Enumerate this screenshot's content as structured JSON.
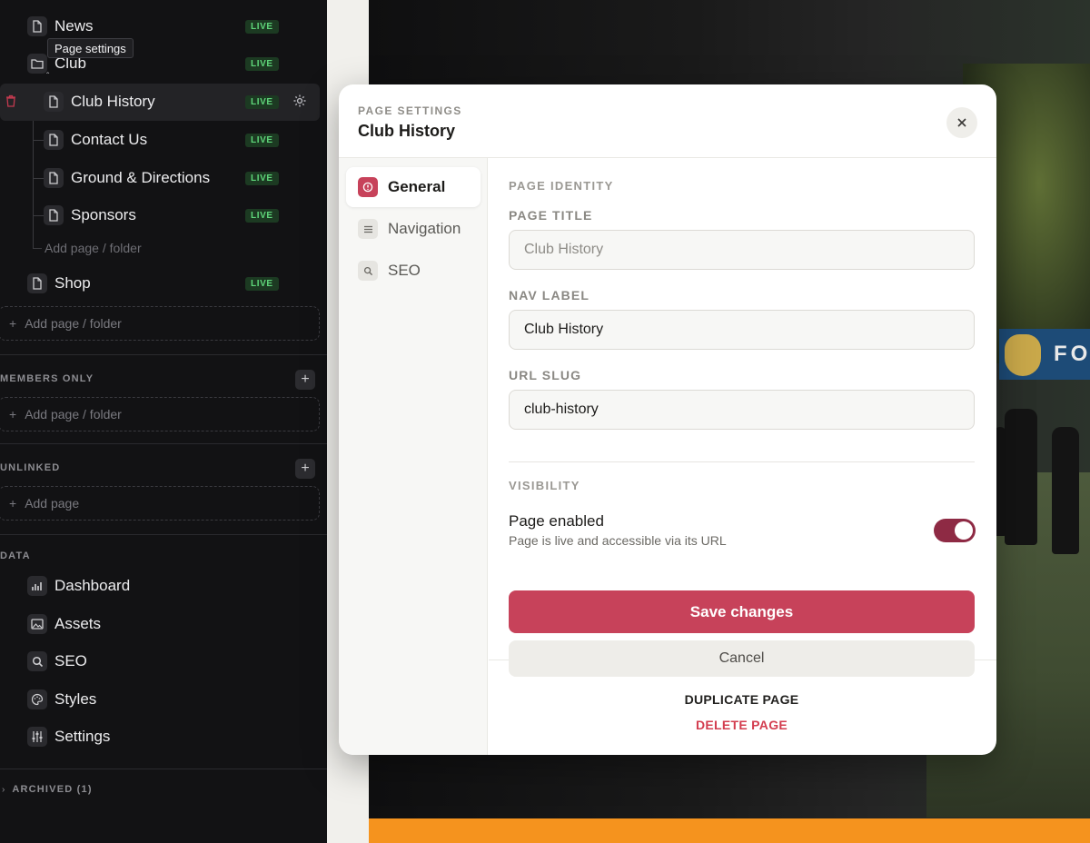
{
  "sidebar": {
    "tooltip": "Page settings",
    "pages": [
      {
        "label": "News",
        "badge": "LIVE"
      },
      {
        "label": "Club",
        "badge": "LIVE"
      },
      {
        "label": "Club History",
        "badge": "LIVE"
      },
      {
        "label": "Contact Us",
        "badge": "LIVE"
      },
      {
        "label": "Ground & Directions",
        "badge": "LIVE"
      },
      {
        "label": "Sponsors",
        "badge": "LIVE"
      },
      {
        "label": "Shop",
        "badge": "LIVE"
      }
    ],
    "club_add_label": "Add page / folder",
    "main_add_label": "Add page / folder",
    "members_only": {
      "heading": "MEMBERS ONLY",
      "add_label": "Add page / folder"
    },
    "unlinked": {
      "heading": "UNLINKED",
      "add_label": "Add page"
    },
    "data": {
      "heading": "DATA",
      "items": [
        {
          "label": "Dashboard",
          "icon": "bar-chart-icon"
        },
        {
          "label": "Assets",
          "icon": "image-icon"
        },
        {
          "label": "SEO",
          "icon": "search-icon"
        },
        {
          "label": "Styles",
          "icon": "palette-icon"
        },
        {
          "label": "Settings",
          "icon": "sliders-icon"
        }
      ]
    },
    "archived": "ARCHIVED (1)"
  },
  "preview": {
    "banner_text": "FO"
  },
  "modal": {
    "kicker": "PAGE SETTINGS",
    "title": "Club History",
    "nav": [
      {
        "label": "General",
        "icon": "info-icon",
        "active": true
      },
      {
        "label": "Navigation",
        "icon": "menu-icon",
        "active": false
      },
      {
        "label": "SEO",
        "icon": "search-icon",
        "active": false
      }
    ],
    "page_identity": "PAGE IDENTITY",
    "page_title": {
      "label": "PAGE TITLE",
      "value": "",
      "placeholder": "Club History"
    },
    "nav_label": {
      "label": "NAV LABEL",
      "value": "Club History"
    },
    "url_slug": {
      "label": "URL SLUG",
      "value": "club-history"
    },
    "visibility": {
      "heading": "VISIBILITY",
      "title": "Page enabled",
      "subtitle": "Page is live and accessible via its URL",
      "enabled": true
    },
    "save_label": "Save changes",
    "cancel_label": "Cancel",
    "duplicate_label": "DUPLICATE PAGE",
    "delete_label": "DELETE PAGE"
  },
  "colors": {
    "accent": "#c7425a",
    "toggle_on": "#8e2a44",
    "live_badge": "#5fd67a",
    "delete": "#d33d4f"
  }
}
